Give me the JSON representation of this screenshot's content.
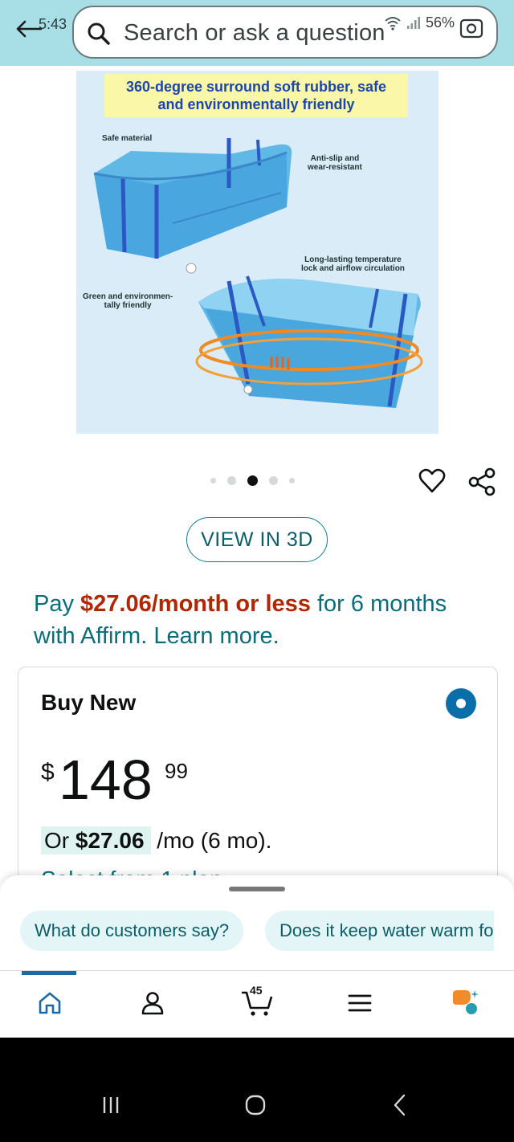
{
  "status_bar": {
    "time": "5:43",
    "battery": "56%"
  },
  "search": {
    "placeholder": "Search or ask a question"
  },
  "product_image": {
    "banner_line1": "360-degree surround soft rubber, safe",
    "banner_line2": "and environmentally friendly",
    "labels": {
      "safe_material": "Safe material",
      "anti_slip_1": "Anti-slip and",
      "anti_slip_2": "wear-resistant",
      "long_lasting_1": "Long-lasting temperature",
      "long_lasting_2": "lock and airflow circulation",
      "green_1": "Green and environmen-",
      "green_2": "tally friendly"
    }
  },
  "view3d": {
    "label": "VIEW IN 3D"
  },
  "affirm": {
    "prefix": "Pay ",
    "amount": "$27.06/month or less",
    "suffix": " for 6 months with Affirm. Learn more."
  },
  "buy_box": {
    "title": "Buy New",
    "price_symbol": "$",
    "price_whole": "148",
    "price_fraction": "99",
    "mo_prefix": "Or ",
    "mo_amount": "$27.06",
    "mo_suffix": " /mo (6 mo).",
    "select_plan": "Select from 1 plan"
  },
  "chips": [
    {
      "label": "What do customers say?"
    },
    {
      "label": "Does it keep water warm fo"
    }
  ],
  "nav": {
    "cart_count": "45"
  },
  "colors": {
    "header_bg": "#a8dfe6",
    "link": "#0a6d78",
    "price_highlight": "#b12704",
    "active_tab": "#1b6aa5"
  },
  "icons": [
    "back-arrow-icon",
    "search-icon",
    "wifi-icon",
    "signal-icon",
    "lens-icon",
    "heart-icon",
    "share-icon",
    "home-icon",
    "account-icon",
    "cart-icon",
    "menu-icon",
    "rufus-icon",
    "recents-icon",
    "home-circle-icon",
    "back-chevron-icon"
  ]
}
